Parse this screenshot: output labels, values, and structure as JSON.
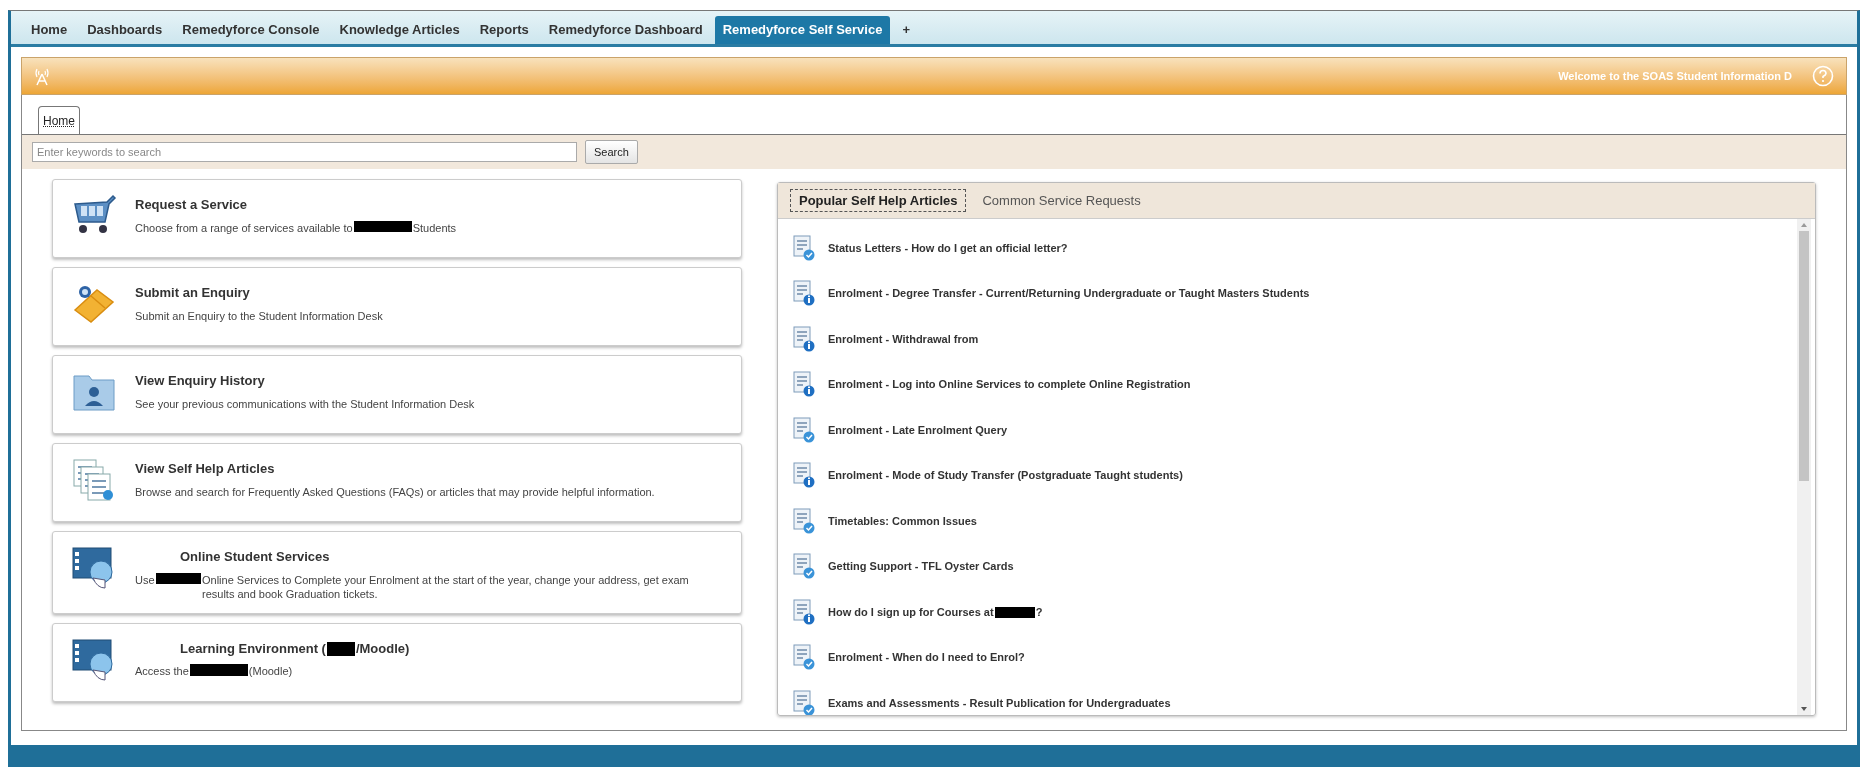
{
  "nav_tabs": [
    {
      "label": "Home",
      "selected": false
    },
    {
      "label": "Dashboards",
      "selected": false
    },
    {
      "label": "Remedyforce Console",
      "selected": false
    },
    {
      "label": "Knowledge Articles",
      "selected": false
    },
    {
      "label": "Reports",
      "selected": false
    },
    {
      "label": "Remedyforce Dashboard",
      "selected": false
    },
    {
      "label": "Remedyforce Self Service",
      "selected": true
    },
    {
      "label": "+",
      "selected": false
    }
  ],
  "header": {
    "welcome": "Welcome to the SOAS Student Information D"
  },
  "page_tabs": [
    {
      "label": "Home",
      "selected": true
    }
  ],
  "search": {
    "placeholder": "Enter keywords to search",
    "button": "Search"
  },
  "cards": [
    {
      "kind": "cart",
      "title": [
        {
          "kind": "text",
          "text": "Request a Service"
        }
      ],
      "description": [
        {
          "kind": "text",
          "text": "Choose from a range of services available to"
        },
        {
          "kind": "redacted"
        },
        {
          "kind": "text",
          "text": "Students"
        }
      ]
    },
    {
      "kind": "ticket",
      "title": [
        {
          "kind": "text",
          "text": "Submit an Enquiry"
        }
      ],
      "description": [
        {
          "kind": "text",
          "text": "Submit an Enquiry to the Student Information Desk"
        }
      ]
    },
    {
      "kind": "folder",
      "title": [
        {
          "kind": "text",
          "text": "View Enquiry History"
        }
      ],
      "description": [
        {
          "kind": "text",
          "text": "See your previous communications with the Student Information Desk"
        }
      ]
    },
    {
      "kind": "documents",
      "title": [
        {
          "kind": "text",
          "text": "View Self Help Articles"
        }
      ],
      "description": [
        {
          "kind": "text",
          "text": "Browse and search for Frequently Asked Questions (FAQs) or articles that may provide helpful information."
        }
      ]
    },
    {
      "kind": "portal",
      "title": [
        {
          "kind": "text",
          "text": "Online Student Services"
        }
      ],
      "description": [
        {
          "kind": "text",
          "text": "Use"
        },
        {
          "kind": "redacted"
        },
        {
          "kind": "text",
          "text": "Online Services to Complete your Enrolment at the start of the year, change your address, get exam results and book Graduation tickets."
        }
      ]
    },
    {
      "kind": "portal",
      "title": [
        {
          "kind": "text",
          "text": "Learning Environment ("
        },
        {
          "kind": "redacted"
        },
        {
          "kind": "text",
          "text": "/Moodle)"
        }
      ],
      "description": [
        {
          "kind": "text",
          "text": "Access the"
        },
        {
          "kind": "redacted"
        },
        {
          "kind": "text",
          "text": "(Moodle)"
        }
      ]
    }
  ],
  "articles_panel": {
    "tabs": [
      {
        "label": "Popular Self Help Articles",
        "selected": true
      },
      {
        "label": "Common Service Requests",
        "selected": false
      }
    ],
    "articles": [
      {
        "kind": "help",
        "title": [
          {
            "kind": "text",
            "text": "Status Letters - How do I get an official letter?"
          }
        ]
      },
      {
        "kind": "info",
        "title": [
          {
            "kind": "text",
            "text": "Enrolment - Degree Transfer - Current/Returning Undergraduate or Taught Masters Students"
          }
        ]
      },
      {
        "kind": "info",
        "title": [
          {
            "kind": "text",
            "text": "Enrolment - Withdrawal from"
          }
        ]
      },
      {
        "kind": "info",
        "title": [
          {
            "kind": "text",
            "text": "Enrolment - Log into Online Services to complete Online Registration"
          }
        ]
      },
      {
        "kind": "help",
        "title": [
          {
            "kind": "text",
            "text": "Enrolment - Late Enrolment Query"
          }
        ]
      },
      {
        "kind": "info",
        "title": [
          {
            "kind": "text",
            "text": "Enrolment - Mode of Study Transfer (Postgraduate Taught students)"
          }
        ]
      },
      {
        "kind": "help",
        "title": [
          {
            "kind": "text",
            "text": "Timetables: Common Issues"
          }
        ]
      },
      {
        "kind": "help",
        "title": [
          {
            "kind": "text",
            "text": "Getting Support - TFL Oyster Cards"
          }
        ]
      },
      {
        "kind": "info",
        "title": [
          {
            "kind": "text",
            "text": "How do I sign up for Courses at"
          },
          {
            "kind": "redacted"
          },
          {
            "kind": "text",
            "text": "?"
          }
        ]
      },
      {
        "kind": "help",
        "title": [
          {
            "kind": "text",
            "text": "Enrolment - When do I need to Enrol?"
          }
        ]
      },
      {
        "kind": "help",
        "title": [
          {
            "kind": "text",
            "text": "Exams and Assessments - Result Publication for Undergraduates"
          }
        ]
      }
    ]
  }
}
